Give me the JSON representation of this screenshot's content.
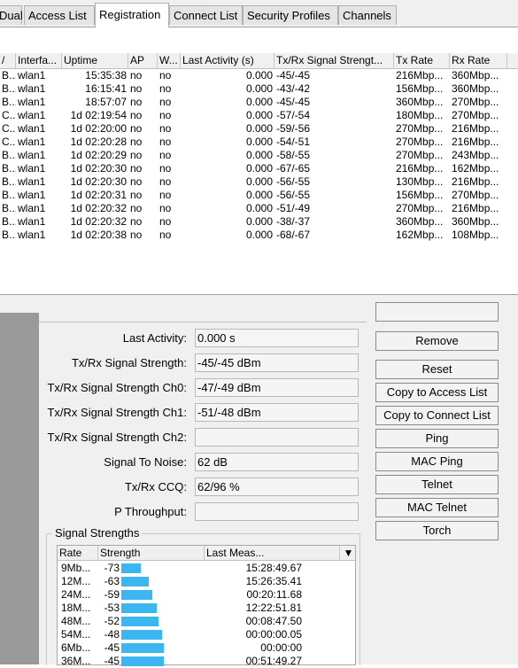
{
  "tabs": [
    {
      "label": "Dual"
    },
    {
      "label": "Access List"
    },
    {
      "label": "Registration"
    },
    {
      "label": "Connect List"
    },
    {
      "label": "Security Profiles"
    },
    {
      "label": "Channels"
    }
  ],
  "active_tab_index": 2,
  "registration": {
    "columns": [
      "Interfa...",
      "Uptime",
      "AP",
      "W...",
      "Last Activity (s)",
      "Tx/Rx Signal Strengt...",
      "Tx Rate",
      "Rx Rate"
    ],
    "rows": [
      {
        "mac": "B...",
        "iface": "wlan1",
        "uptime": "15:35:38",
        "ap": "no",
        "w": "no",
        "last": "0.000",
        "signal": "-45/-45",
        "tx": "216Mbp...",
        "rx": "360Mbp..."
      },
      {
        "mac": "B...",
        "iface": "wlan1",
        "uptime": "16:15:41",
        "ap": "no",
        "w": "no",
        "last": "0.000",
        "signal": "-43/-42",
        "tx": "156Mbp...",
        "rx": "360Mbp..."
      },
      {
        "mac": "B...",
        "iface": "wlan1",
        "uptime": "18:57:07",
        "ap": "no",
        "w": "no",
        "last": "0.000",
        "signal": "-45/-45",
        "tx": "360Mbp...",
        "rx": "270Mbp..."
      },
      {
        "mac": "C...",
        "iface": "wlan1",
        "uptime": "1d 02:19:54",
        "ap": "no",
        "w": "no",
        "last": "0.000",
        "signal": "-57/-54",
        "tx": "180Mbp...",
        "rx": "270Mbp..."
      },
      {
        "mac": "C...",
        "iface": "wlan1",
        "uptime": "1d 02:20:00",
        "ap": "no",
        "w": "no",
        "last": "0.000",
        "signal": "-59/-56",
        "tx": "270Mbp...",
        "rx": "216Mbp..."
      },
      {
        "mac": "C...",
        "iface": "wlan1",
        "uptime": "1d 02:20:28",
        "ap": "no",
        "w": "no",
        "last": "0.000",
        "signal": "-54/-51",
        "tx": "270Mbp...",
        "rx": "216Mbp..."
      },
      {
        "mac": "B...",
        "iface": "wlan1",
        "uptime": "1d 02:20:29",
        "ap": "no",
        "w": "no",
        "last": "0.000",
        "signal": "-58/-55",
        "tx": "270Mbp...",
        "rx": "243Mbp..."
      },
      {
        "mac": "B...",
        "iface": "wlan1",
        "uptime": "1d 02:20:30",
        "ap": "no",
        "w": "no",
        "last": "0.000",
        "signal": "-67/-65",
        "tx": "216Mbp...",
        "rx": "162Mbp..."
      },
      {
        "mac": "B...",
        "iface": "wlan1",
        "uptime": "1d 02:20:30",
        "ap": "no",
        "w": "no",
        "last": "0.000",
        "signal": "-56/-55",
        "tx": "130Mbp...",
        "rx": "216Mbp..."
      },
      {
        "mac": "B...",
        "iface": "wlan1",
        "uptime": "1d 02:20:31",
        "ap": "no",
        "w": "no",
        "last": "0.000",
        "signal": "-56/-55",
        "tx": "156Mbp...",
        "rx": "270Mbp..."
      },
      {
        "mac": "B...",
        "iface": "wlan1",
        "uptime": "1d 02:20:32",
        "ap": "no",
        "w": "no",
        "last": "0.000",
        "signal": "-51/-49",
        "tx": "270Mbp...",
        "rx": "216Mbp..."
      },
      {
        "mac": "B...",
        "iface": "wlan1",
        "uptime": "1d 02:20:32",
        "ap": "no",
        "w": "no",
        "last": "0.000",
        "signal": "-38/-37",
        "tx": "360Mbp...",
        "rx": "360Mbp..."
      },
      {
        "mac": "B...",
        "iface": "wlan1",
        "uptime": "1d 02:20:38",
        "ap": "no",
        "w": "no",
        "last": "0.000",
        "signal": "-68/-67",
        "tx": "162Mbp...",
        "rx": "108Mbp..."
      }
    ]
  },
  "details": {
    "fields": [
      {
        "label": "Last Activity:",
        "value": "0.000 s"
      },
      {
        "label": "Tx/Rx Signal Strength:",
        "value": "-45/-45 dBm"
      },
      {
        "label": "Tx/Rx Signal Strength Ch0:",
        "value": "-47/-49 dBm"
      },
      {
        "label": "Tx/Rx Signal Strength Ch1:",
        "value": "-51/-48 dBm"
      },
      {
        "label": "Tx/Rx Signal Strength Ch2:",
        "value": ""
      },
      {
        "label": "Signal To Noise:",
        "value": "62 dB"
      },
      {
        "label": "Tx/Rx CCQ:",
        "value": "62/96 %"
      },
      {
        "label": "P Throughput:",
        "value": ""
      }
    ],
    "buttons": [
      "Remove",
      "Reset",
      "Copy to Access List",
      "Copy to Connect List",
      "Ping",
      "MAC Ping",
      "Telnet",
      "MAC Telnet",
      "Torch"
    ]
  },
  "signal_strengths": {
    "title": "Signal Strengths",
    "columns": [
      "Rate",
      "Strength",
      "Last Meas..."
    ],
    "rows": [
      {
        "rate": "9Mb...",
        "strength": "-73",
        "last": "15:28:49.67",
        "level": 0.33
      },
      {
        "rate": "12M...",
        "strength": "-63",
        "last": "15:26:35.41",
        "level": 0.47
      },
      {
        "rate": "24M...",
        "strength": "-59",
        "last": "00:20:11.68",
        "level": 0.53
      },
      {
        "rate": "18M...",
        "strength": "-53",
        "last": "12:22:51.81",
        "level": 0.61
      },
      {
        "rate": "48M...",
        "strength": "-52",
        "last": "00:08:47.50",
        "level": 0.63
      },
      {
        "rate": "54M...",
        "strength": "-48",
        "last": "00:00:00.05",
        "level": 0.69
      },
      {
        "rate": "6Mb...",
        "strength": "-45",
        "last": "00:00:00",
        "level": 0.73
      },
      {
        "rate": "36M...",
        "strength": "-45",
        "last": "00:51:49.27",
        "level": 0.73
      }
    ]
  }
}
